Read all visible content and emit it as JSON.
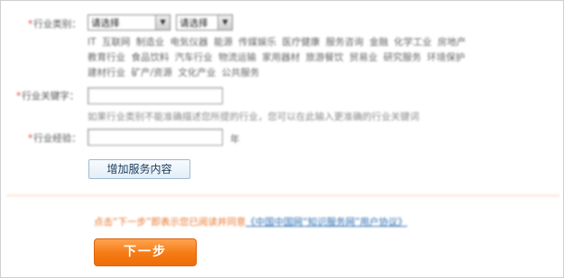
{
  "industry": {
    "label": "行业类别：",
    "select_primary": "请选择",
    "select_secondary": "请选择",
    "options": [
      "IT 互联网 制造业 电気仪器 能源 传媒娱乐 医疗健康 服务咨询 金融 化学工业 房地产",
      "教育行业 食品饮料 汽车行业 物流运输 家用器材 旅游餐饮 贸易业 研究服务 环境保护",
      "建材行业 矿产/资源 文化产业 公共服务"
    ]
  },
  "keyword": {
    "label": "行业关键字：",
    "value": "",
    "hint": "如果行业类别不能准确描述您所提的行业，您可以在此输入更准确的行业关键词"
  },
  "experience": {
    "label": "行业经验：",
    "value": "",
    "unit": "年"
  },
  "add_service_button": "增加服务内容",
  "notice": {
    "text": "点击“下一步”即表示您已阅读并同意",
    "link": "《中国中国网“知识服务网”用户协议》"
  },
  "next_button": "下一步",
  "colors": {
    "required": "#e03a3a",
    "accent_orange": "#f57a15",
    "link_blue": "#2b6cb0"
  }
}
